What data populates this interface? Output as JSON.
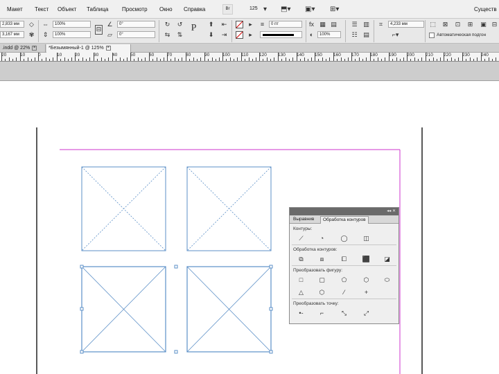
{
  "menu": {
    "items": [
      "Макет",
      "Текст",
      "Объект",
      "Таблица",
      "Просмотр",
      "Окно",
      "Справка"
    ],
    "br_icon": "Br",
    "zoom": "125",
    "right_label": "Существ"
  },
  "control": {
    "x_value": "2,833 мм",
    "y_value": "3,167 мм",
    "scale_x": "100%",
    "scale_y": "100%",
    "angle": "0°",
    "shear": "0°",
    "stroke_weight": "0 пт",
    "opacity": "100%",
    "width_value": "4,233 мм",
    "autofit_label": "Автоматическая подгон",
    "accent_color": "#d40000"
  },
  "tabs": [
    {
      "label": ".indd @ 22%",
      "active": false
    },
    {
      "label": "*Безымянный-1 @ 125%",
      "active": true
    }
  ],
  "ruler": {
    "labels": [
      "20",
      "10",
      "0",
      "10",
      "20",
      "30",
      "40",
      "50",
      "60",
      "70",
      "80",
      "90",
      "100",
      "110",
      "120",
      "130",
      "140",
      "150",
      "160",
      "170",
      "180",
      "190",
      "200",
      "210",
      "220",
      "230",
      "240"
    ]
  },
  "panel": {
    "collapse": "◂◂ ✕",
    "tab_align": "Выравнив",
    "tab_pathfinder": "Обработка контуров",
    "sec_paths": "Контуры:",
    "sec_pathfinder": "Обработка контуров:",
    "sec_convert_shape": "Преобразовать фигуру:",
    "sec_convert_point": "Преобразовать точку:"
  },
  "colors": {
    "frame_stroke": "#5b8fc7",
    "margin_guide": "#cc33cc",
    "page_edge": "#111111"
  }
}
